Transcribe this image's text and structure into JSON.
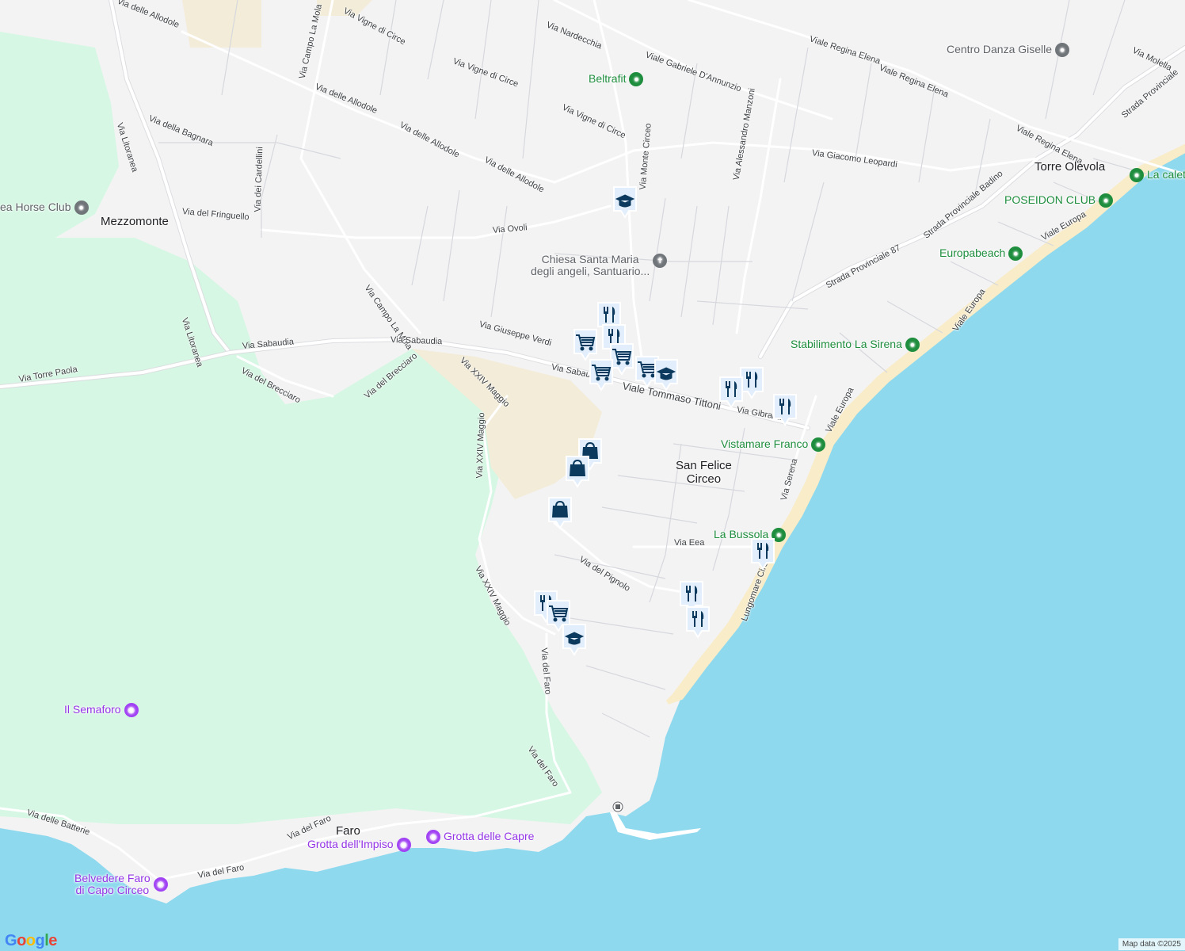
{
  "places": {
    "mezzomonte": "Mezzomonte",
    "san_felice": "San Felice\nCirceo",
    "torre_olevola": "Torre Olevola",
    "faro": "Faro"
  },
  "pois": {
    "beltrafit": "Beltrafit",
    "centro_danza": "Centro Danza Giselle",
    "horse_club": "ea Horse Club",
    "chiesa": "Chiesa Santa Maria\ndegli angeli, Santuario...",
    "la_calet": "La calet",
    "poseidon": "POSEIDON CLUB",
    "europabeach": "Europabeach",
    "sirena": "Stabilimento La Sirena",
    "vistamare": "Vistamare Franco",
    "bussola": "La Bussola",
    "semaforo": "Il Semaforo",
    "impiso": "Grotta dell'Impiso",
    "capre": "Grotta delle Capre",
    "belvedere": "Belvedere Faro\ndi Capo Circeo"
  },
  "streets": [
    "Via delle Allodole",
    "Via Vigne di Circe",
    "Via Campo La Mola",
    "Via Nardecchia",
    "Viale Regina Elena",
    "Via Molella",
    "Viale Gabriele D'Annunzio",
    "Strada Provinciale",
    "Via della Bagnara",
    "Via dei Cardellini",
    "Via Litoranea",
    "Via Giacomo Leopardi",
    "Via Alessandro Manzoni",
    "Via del Fringuello",
    "Via Ovoli",
    "Strada Provinciale Badino",
    "Viale Europa",
    "Via Giuseppe Verdi",
    "Strada Provinciale 87",
    "Via Sabaudia",
    "Via Torre Paola",
    "Via del Brecciaro",
    "Via XXIV Maggio",
    "Viale Tommaso Tittoni",
    "Via Gibraltar",
    "Via Serena",
    "Via Eea",
    "Via del Pignolo",
    "Lungomare Circeo",
    "Via del Faro",
    "Via delle Batterie",
    "Via Monte Circeo"
  ],
  "icons": {
    "restaurant": "fork-knife-icon",
    "shopping": "shopping-cart-icon",
    "school": "graduation-cap-icon",
    "store": "shopping-bag-icon",
    "camera": "camera-icon",
    "cross": "church-cross-icon",
    "pin": "location-pin-icon"
  },
  "colors": {
    "land": "#f4f3f4",
    "water": "#8ed9ee",
    "park": "#d5f7e3",
    "beach": "#f9ecc8",
    "road": "#ffffff",
    "marker_fill": "#e2eefb",
    "marker_icon": "#0c3a5e"
  },
  "footer": {
    "logo": "Google",
    "attribution": "Map data ©2025"
  }
}
